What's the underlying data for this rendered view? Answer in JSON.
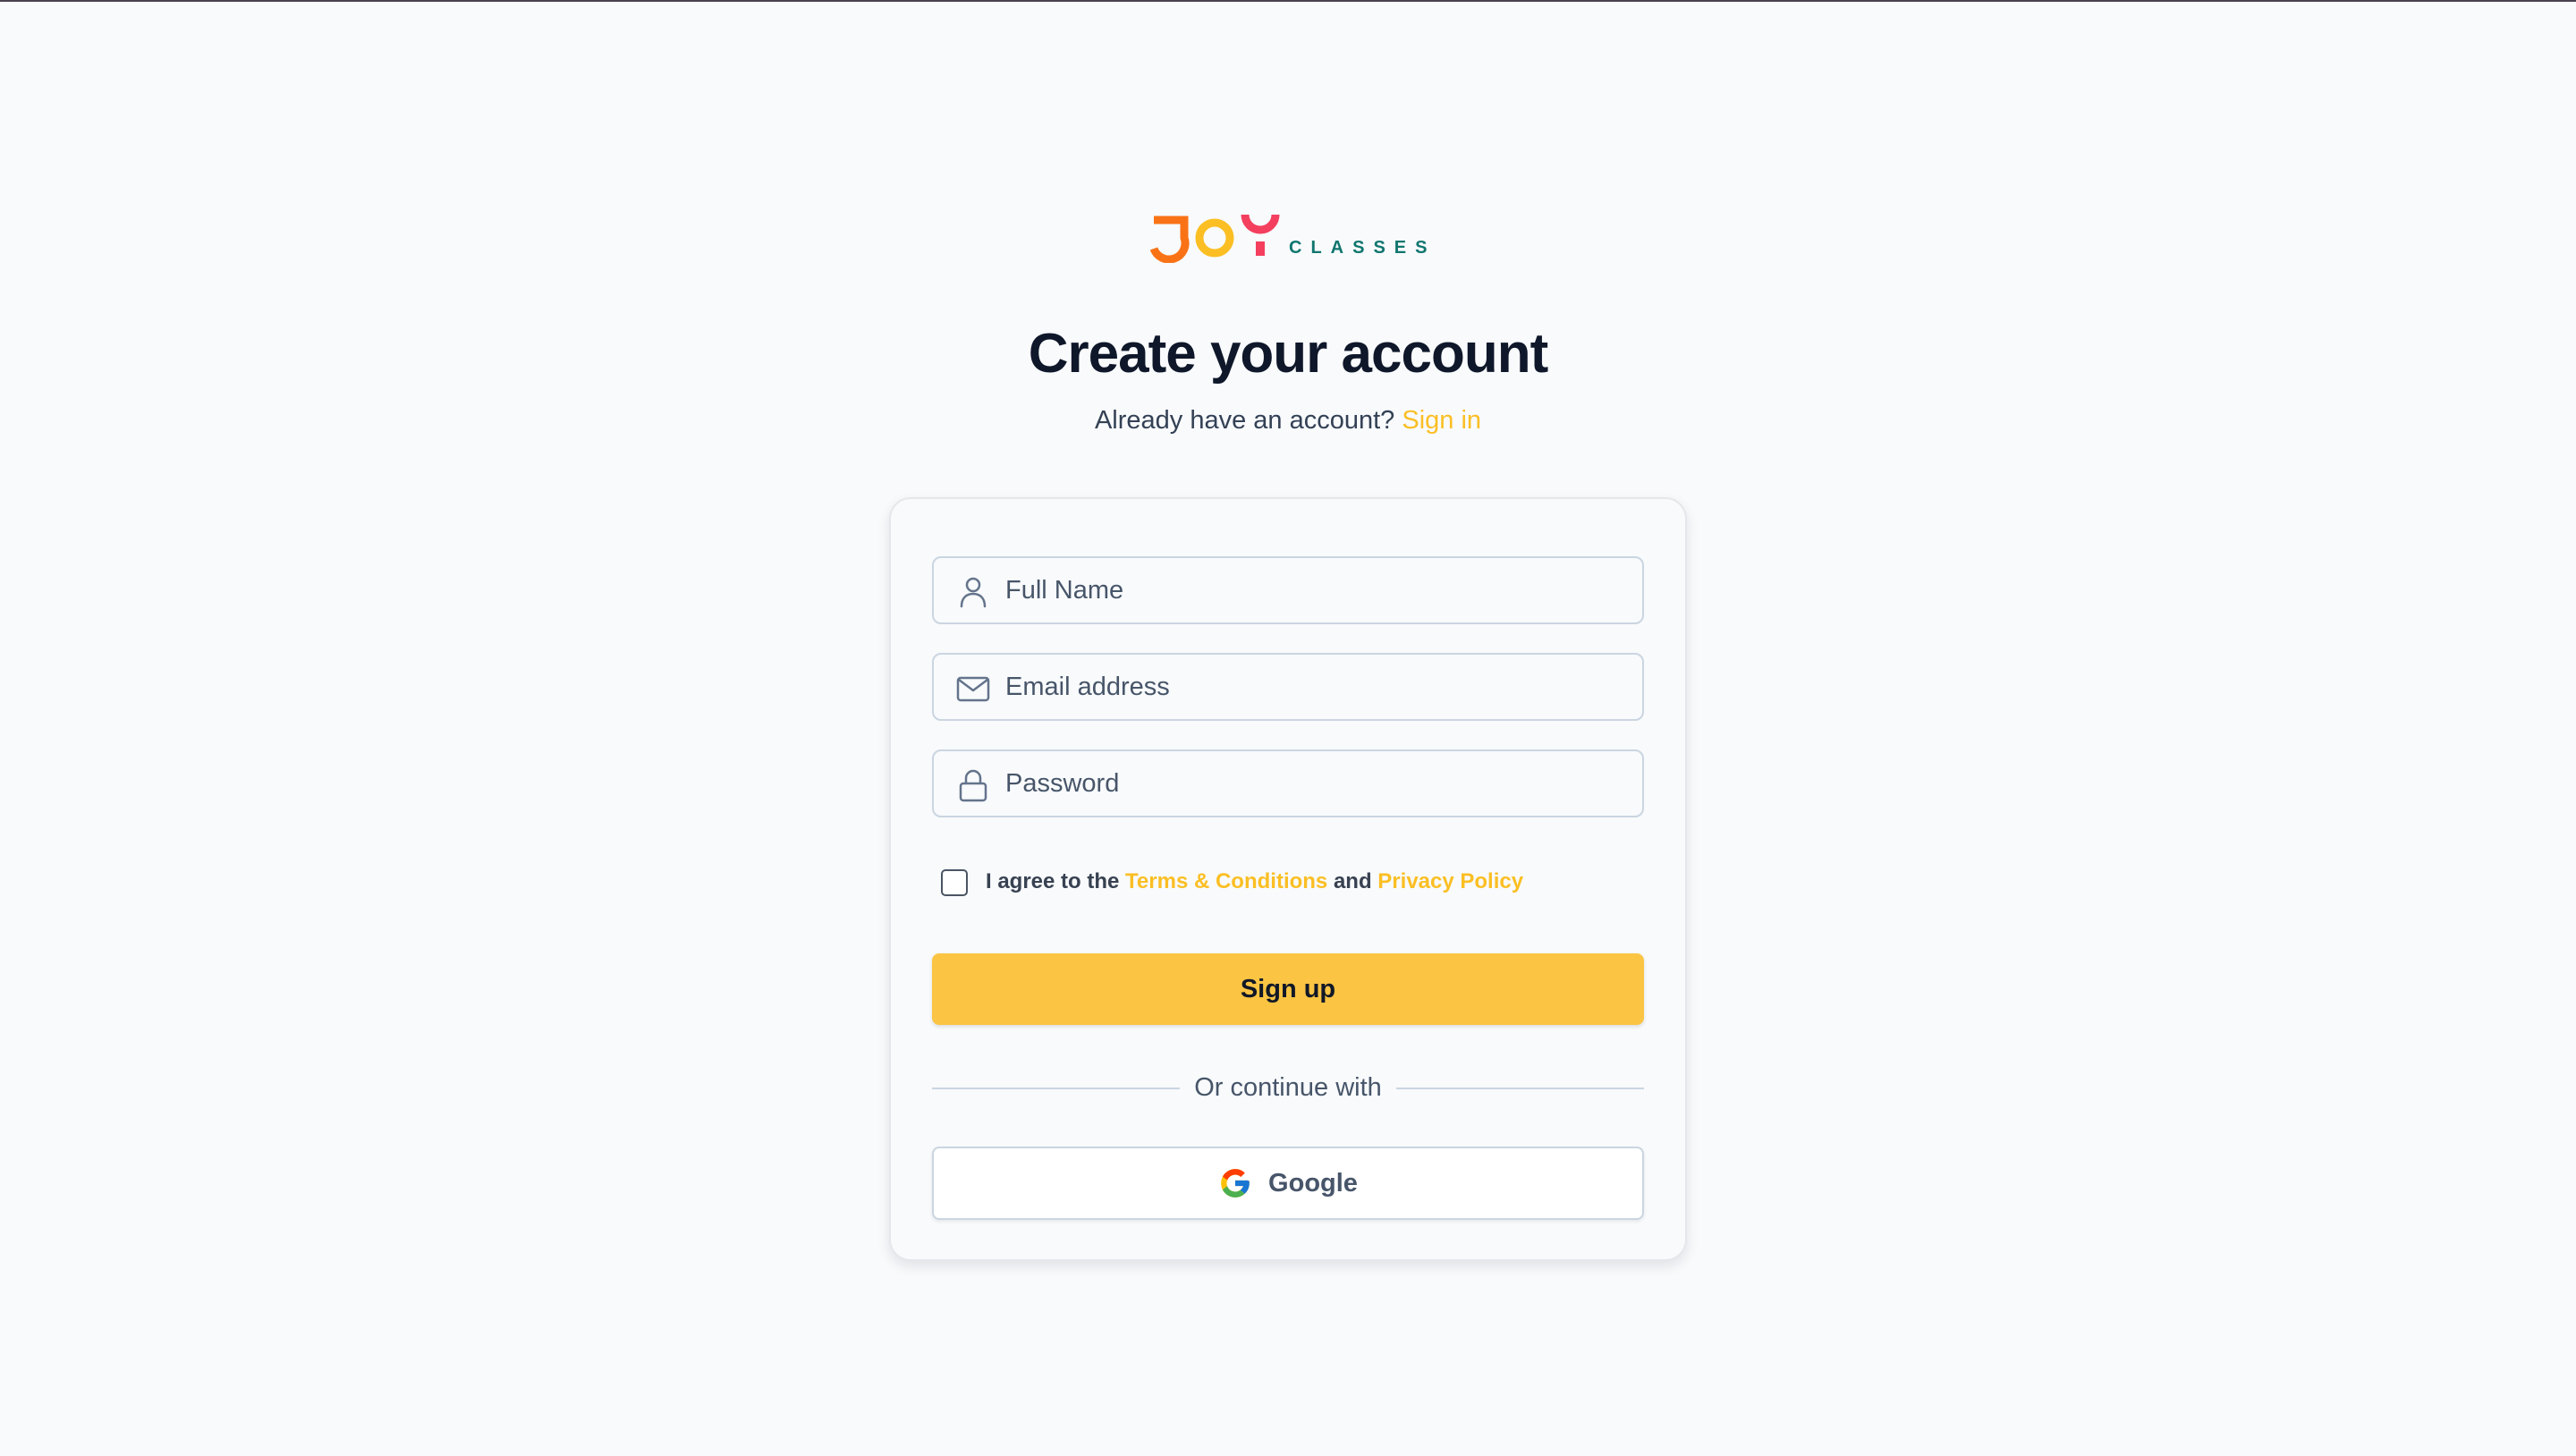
{
  "brand": {
    "logo_word": "JOY",
    "logo_subtext": "CLASSES",
    "colors": {
      "orange": "#f97316",
      "yellow": "#fbbf24",
      "red": "#f43f5e",
      "teal": "#0f766e"
    }
  },
  "heading": {
    "title": "Create your account",
    "subtitle_prefix": "Already have an account?",
    "signin_link": "Sign in"
  },
  "form": {
    "full_name": {
      "placeholder": "Full Name",
      "value": "",
      "icon": "user-icon"
    },
    "email": {
      "placeholder": "Email address",
      "value": "",
      "icon": "mail-icon"
    },
    "password": {
      "placeholder": "Password",
      "value": "",
      "icon": "lock-icon"
    },
    "agree": {
      "checked": false,
      "prefix": "I agree to the",
      "terms_link": "Terms & Conditions",
      "conjunction": "and",
      "privacy_link": "Privacy Policy"
    },
    "submit_label": "Sign up",
    "divider_text": "Or continue with",
    "google_label": "Google"
  },
  "theme": {
    "accent": "#fbbf24",
    "button_bg": "#fbc443",
    "page_bg": "#f8fafc",
    "title_color": "#0f172a"
  }
}
